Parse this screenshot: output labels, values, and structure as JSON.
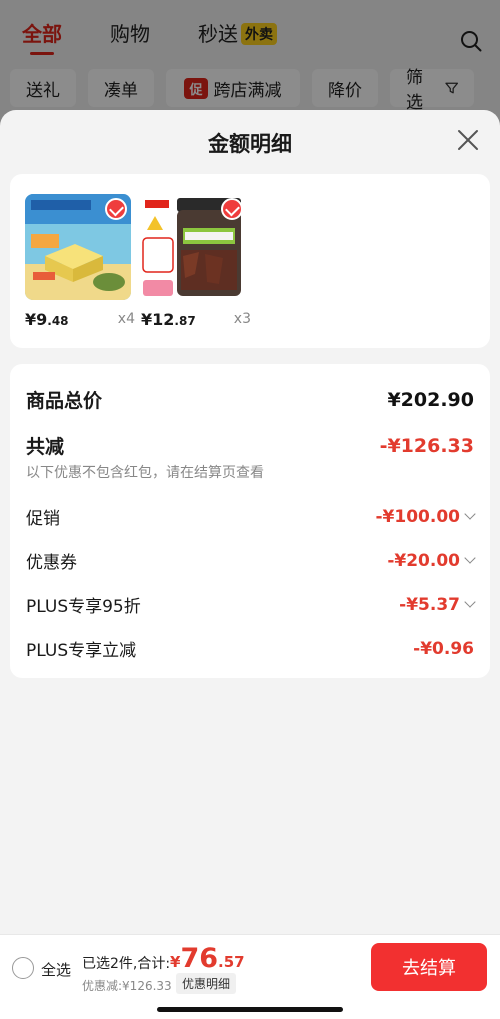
{
  "background": {
    "tabs": [
      {
        "label": "全部"
      },
      {
        "label": "购物"
      },
      {
        "label": "秒送",
        "badge": "外卖"
      }
    ],
    "filters": [
      {
        "label": "送礼"
      },
      {
        "label": "凑单"
      },
      {
        "label": "跨店满减",
        "icon_text": "促"
      },
      {
        "label": "降价"
      },
      {
        "label": "筛选"
      }
    ]
  },
  "sheet": {
    "title": "金额明细",
    "products": [
      {
        "price_int": "¥9",
        "price_dec": ".48",
        "qty": "x4",
        "image": "mung-bean-cake-box"
      },
      {
        "price_int": "¥12",
        "price_dec": ".87",
        "qty": "x3",
        "image": "chicken-breast-jerky-jar"
      }
    ],
    "summary": {
      "total_label": "商品总价",
      "total_value": "¥202.90",
      "reduce_label": "共减",
      "reduce_value": "-¥126.33",
      "note": "以下优惠不包含红包，请在结算页查看",
      "items": [
        {
          "label": "促销",
          "value": "-¥100.00"
        },
        {
          "label": "优惠券",
          "value": "-¥20.00"
        },
        {
          "label": "PLUS专享95折",
          "value": "-¥5.37"
        },
        {
          "label": "PLUS专享立减",
          "value": "-¥0.96"
        }
      ]
    }
  },
  "bottom": {
    "select_all": "全选",
    "selected_text": "已选2件,合计:",
    "total_symbol": "¥",
    "total_int": "76",
    "total_dec": ".57",
    "discount_text": "优惠减:¥126.33",
    "detail_label": "优惠明细",
    "checkout_label": "去结算"
  },
  "colors": {
    "accent": "#e23b2e",
    "button": "#f23030",
    "badge": "#ffd21e"
  }
}
